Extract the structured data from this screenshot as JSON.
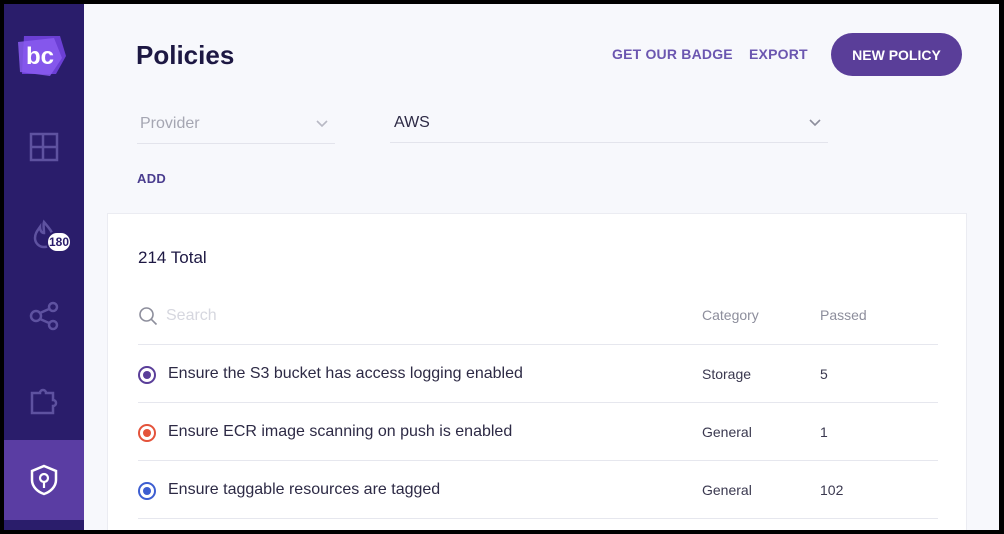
{
  "app": {
    "logo_text": "bc"
  },
  "sidebar": {
    "items": [
      {
        "name": "dashboard",
        "icon": "dashboard-grid-icon"
      },
      {
        "name": "incidents",
        "icon": "flame-icon",
        "badge": "180"
      },
      {
        "name": "integrations",
        "icon": "share-nodes-icon"
      },
      {
        "name": "extensions",
        "icon": "puzzle-icon"
      },
      {
        "name": "policies",
        "icon": "shield-key-icon",
        "active": true
      }
    ]
  },
  "header": {
    "title": "Policies",
    "get_badge_label": "GET OUR BADGE",
    "export_label": "EXPORT",
    "new_policy_label": "NEW POLICY"
  },
  "filters": {
    "provider_placeholder": "Provider",
    "provider_value": "AWS",
    "add_label": "ADD"
  },
  "table": {
    "total_label": "214 Total",
    "search_placeholder": "Search",
    "columns": {
      "category": "Category",
      "passed": "Passed"
    },
    "rows": [
      {
        "title": "Ensure the S3 bucket has access logging enabled",
        "category": "Storage",
        "passed": "5",
        "severity_color": "#5a3e99"
      },
      {
        "title": "Ensure ECR image scanning on push is enabled",
        "category": "General",
        "passed": "1",
        "severity_color": "#e4533b"
      },
      {
        "title": "Ensure taggable resources are tagged",
        "category": "General",
        "passed": "102",
        "severity_color": "#3d5ed1"
      }
    ]
  },
  "colors": {
    "sidebar_bg": "#2a1d6b",
    "sidebar_active": "#5a3da3",
    "accent": "#5a3e99",
    "link": "#6b56b0"
  }
}
